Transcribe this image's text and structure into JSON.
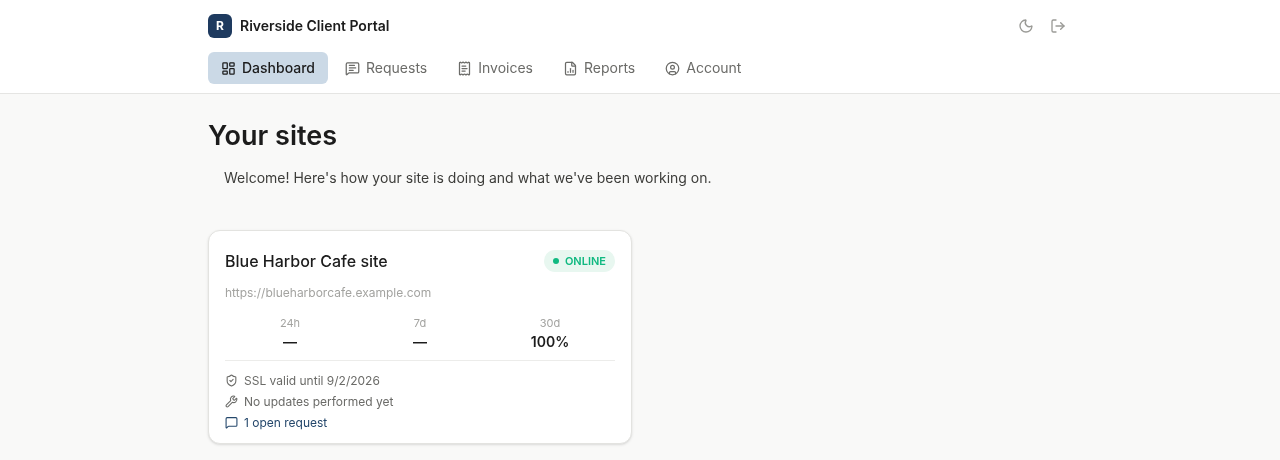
{
  "brand": {
    "logo_letter": "R",
    "title": "Riverside Client Portal"
  },
  "tabs": [
    {
      "label": "Dashboard",
      "kind": "dashboard",
      "selected": true
    },
    {
      "label": "Requests",
      "kind": "requests",
      "selected": false
    },
    {
      "label": "Invoices",
      "kind": "invoices",
      "selected": false
    },
    {
      "label": "Reports",
      "kind": "reports",
      "selected": false
    },
    {
      "label": "Account",
      "kind": "account",
      "selected": false
    }
  ],
  "page": {
    "title": "Your sites",
    "intro": "Welcome! Here's how your site is doing and what we've been working on."
  },
  "sites": [
    {
      "name": "Blue Harbor Cafe site",
      "status": {
        "label": "ONLINE",
        "color": "#10b981"
      },
      "url": "https://blueharborcafe.example.com",
      "uptime": [
        {
          "period": "24h",
          "value": "—"
        },
        {
          "period": "7d",
          "value": "—"
        },
        {
          "period": "30d",
          "value": "100%"
        }
      ],
      "details": [
        {
          "kind": "ssl",
          "text": "SSL valid until 9/2/2026"
        },
        {
          "kind": "updates",
          "text": "No updates performed yet"
        },
        {
          "kind": "request",
          "text": "1 open request"
        }
      ]
    }
  ]
}
